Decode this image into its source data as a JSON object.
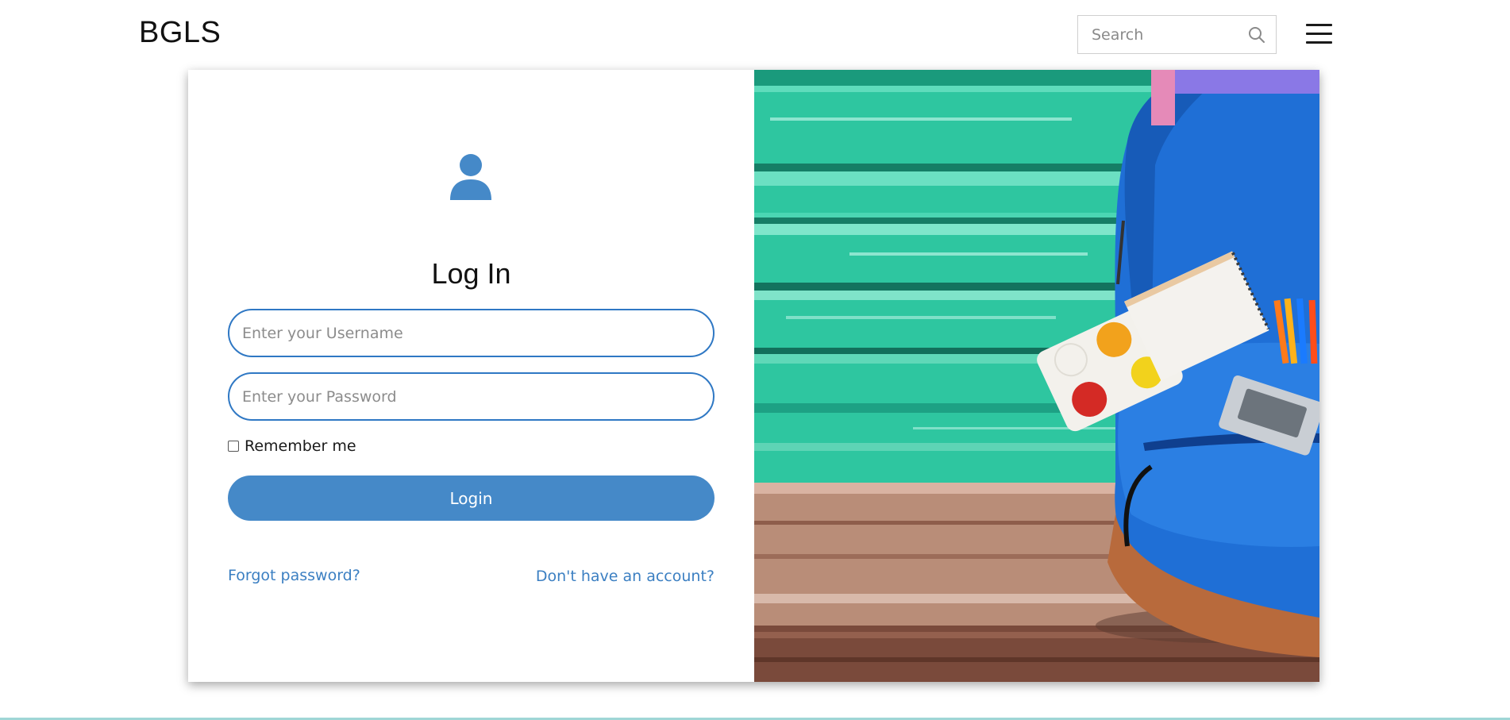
{
  "header": {
    "brand": "BGLS",
    "search_placeholder": "Search",
    "search_icon": "search-icon",
    "menu_icon": "hamburger-menu-icon"
  },
  "login": {
    "user_icon": "user-icon",
    "title": "Log In",
    "username_placeholder": "Enter your Username",
    "password_placeholder": "Enter your Password",
    "remember_label": "Remember me",
    "remember_checked": false,
    "login_button": "Login",
    "forgot_password": "Forgot password?",
    "no_account": "Don't have an account?"
  },
  "image": {
    "description_icon": "backpack-illustration"
  },
  "colors": {
    "accent": "#4589c8",
    "link": "#3b7fc2",
    "input_border": "#2f78c4",
    "wood_teal": "#2fc9a3",
    "backpack_blue": "#1e6fd9"
  }
}
